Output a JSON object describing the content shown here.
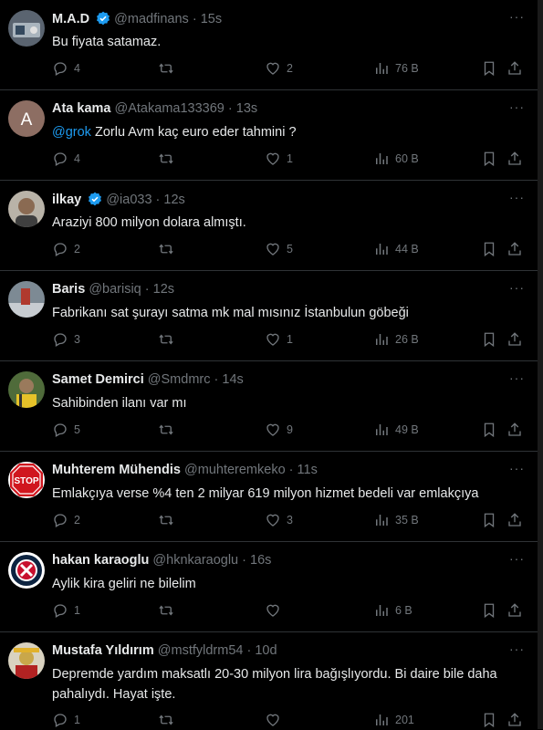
{
  "tweets": [
    {
      "name": "M.A.D",
      "handle": "@madfinans",
      "time": "15s",
      "verified": true,
      "text": "Bu fiyata satamaz.",
      "replies": "4",
      "likes": "2",
      "views": "76 B",
      "avatar": {
        "type": "photo",
        "bg": "#5a6470"
      }
    },
    {
      "name": "Ata kama",
      "handle": "@Atakama133369",
      "time": "13s",
      "verified": false,
      "mention": "@grok",
      "text": " Zorlu Avm kaç euro eder tahmini ?",
      "replies": "4",
      "likes": "1",
      "views": "60 B",
      "avatar": {
        "type": "letter",
        "letter": "A",
        "bg": "#8d6e63"
      }
    },
    {
      "name": "ilkay",
      "handle": "@ia033",
      "time": "12s",
      "verified": true,
      "text": "Araziyi 800 milyon dolara almıştı.",
      "replies": "2",
      "likes": "5",
      "views": "44 B",
      "avatar": {
        "type": "photo",
        "bg": "#8a7b6a"
      }
    },
    {
      "name": "Baris",
      "handle": "@barisiq",
      "time": "12s",
      "verified": false,
      "text": "Fabrikanı sat şurayı satma mk mal mısınız İstanbulun göbeği",
      "replies": "3",
      "likes": "1",
      "views": "26 B",
      "avatar": {
        "type": "photo",
        "bg": "#7d8a94"
      }
    },
    {
      "name": "Samet Demirci",
      "handle": "@Smdmrc",
      "time": "14s",
      "verified": false,
      "text": "Sahibinden ilanı var mı",
      "replies": "5",
      "likes": "9",
      "views": "49 B",
      "avatar": {
        "type": "photo",
        "bg": "#4f6b3a"
      }
    },
    {
      "name": "Muhterem Mühendis",
      "handle": "@muhteremkeko",
      "time": "11s",
      "verified": false,
      "text": "Emlakçıya verse %4 ten 2 milyar 619 milyon hizmet bedeli var emlakçıya",
      "replies": "2",
      "likes": "3",
      "views": "35 B",
      "avatar": {
        "type": "stop",
        "label": "STOP",
        "bg": "#d0161e"
      }
    },
    {
      "name": "hakan karaoglu",
      "handle": "@hknkaraoglu",
      "time": "16s",
      "verified": false,
      "text": "Aylik kira geliri ne bilelim",
      "replies": "1",
      "likes": "",
      "views": "6 B",
      "avatar": {
        "type": "emblem",
        "bg": "#ffffff"
      }
    },
    {
      "name": "Mustafa Yıldırım",
      "handle": "@mstfyldrm54",
      "time": "10d",
      "verified": false,
      "text": "Depremde yardım maksatlı 20-30 milyon lira bağışlıyordu. Bi daire bile daha pahalıydı. Hayat işte.",
      "replies": "1",
      "likes": "",
      "views": "201",
      "avatar": {
        "type": "photo",
        "bg": "#c9a74a"
      }
    }
  ],
  "colors": {
    "background": "#000000",
    "text": "#e7e9ea",
    "muted": "#71767b",
    "accent": "#1d9bf0",
    "divider": "#2f3336"
  }
}
